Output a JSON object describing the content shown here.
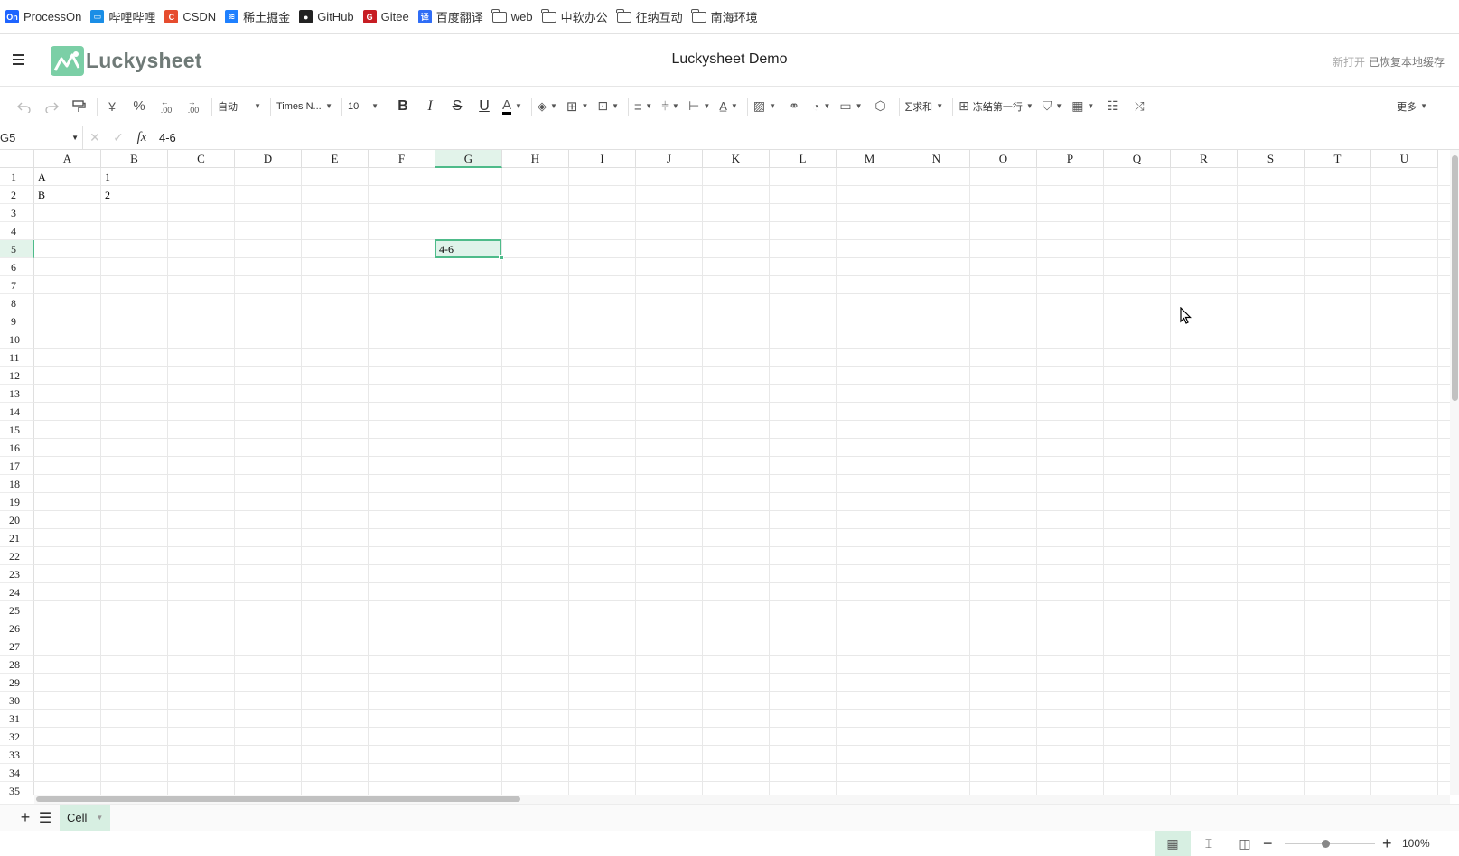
{
  "bookmarks": [
    {
      "label": "ProcessOn",
      "icon": "processon-icon",
      "color": "#1e64ff",
      "glyph": "On"
    },
    {
      "label": "哔哩哔哩",
      "icon": "bilibili-icon",
      "color": "#1a8ee6",
      "glyph": "▭"
    },
    {
      "label": "CSDN",
      "icon": "csdn-icon",
      "color": "#e64c2e",
      "glyph": "C"
    },
    {
      "label": "稀土掘金",
      "icon": "juejin-icon",
      "color": "#1e80ff",
      "glyph": "≋"
    },
    {
      "label": "GitHub",
      "icon": "github-icon",
      "color": "#222222",
      "glyph": "●"
    },
    {
      "label": "Gitee",
      "icon": "gitee-icon",
      "color": "#c71d23",
      "glyph": "G"
    },
    {
      "label": "百度翻译",
      "icon": "baidu-translate-icon",
      "color": "#2f6df6",
      "glyph": "译"
    },
    {
      "label": "web",
      "icon": "folder-icon"
    },
    {
      "label": "中软办公",
      "icon": "folder-icon"
    },
    {
      "label": "征纳互动",
      "icon": "folder-icon"
    },
    {
      "label": "南海环境",
      "icon": "folder-icon"
    }
  ],
  "header": {
    "app_name": "Luckysheet",
    "title": "Luckysheet Demo",
    "status_new": "新打开",
    "status_restored": "已恢复本地缓存"
  },
  "toolbar": {
    "format_label": "自动",
    "font_label": "Times N...",
    "size_label": "10",
    "sum_label": "求和",
    "freeze_label": "冻结第一行",
    "more_label": "更多",
    "bold": "B",
    "italic": "I",
    "strike": "S",
    "underline": "U",
    "text_color": "A",
    "currency": "¥",
    "percent": "%"
  },
  "formula_bar": {
    "name_box": "G5",
    "fx": "fx",
    "value": "4-6"
  },
  "grid": {
    "columns": [
      "A",
      "B",
      "C",
      "D",
      "E",
      "F",
      "G",
      "H",
      "I",
      "J",
      "K",
      "L",
      "M",
      "N",
      "O",
      "P",
      "Q",
      "R",
      "S",
      "T",
      "U"
    ],
    "rows": [
      "1",
      "2",
      "3",
      "4",
      "5",
      "6",
      "7",
      "8",
      "9",
      "10",
      "11",
      "12",
      "13",
      "14",
      "15",
      "16",
      "17",
      "18",
      "19",
      "20",
      "21",
      "22",
      "23",
      "24",
      "25",
      "26",
      "27",
      "28",
      "29",
      "30",
      "31",
      "32",
      "33",
      "34",
      "35"
    ],
    "selected_column": "G",
    "selected_row": "5",
    "cells": {
      "A1": "A",
      "B1": "1",
      "A2": "B",
      "B2": "2",
      "G5": "4-6"
    }
  },
  "sheets": {
    "add": "+",
    "list": "☰",
    "active_tab": "Cell"
  },
  "status_bar": {
    "zoom_out": "−",
    "zoom_in": "+",
    "zoom_level": "100%",
    "zoom_fraction": 0.45
  },
  "colors": {
    "accent": "#4ebb8a",
    "selection_fill": "#e2f3ea"
  }
}
